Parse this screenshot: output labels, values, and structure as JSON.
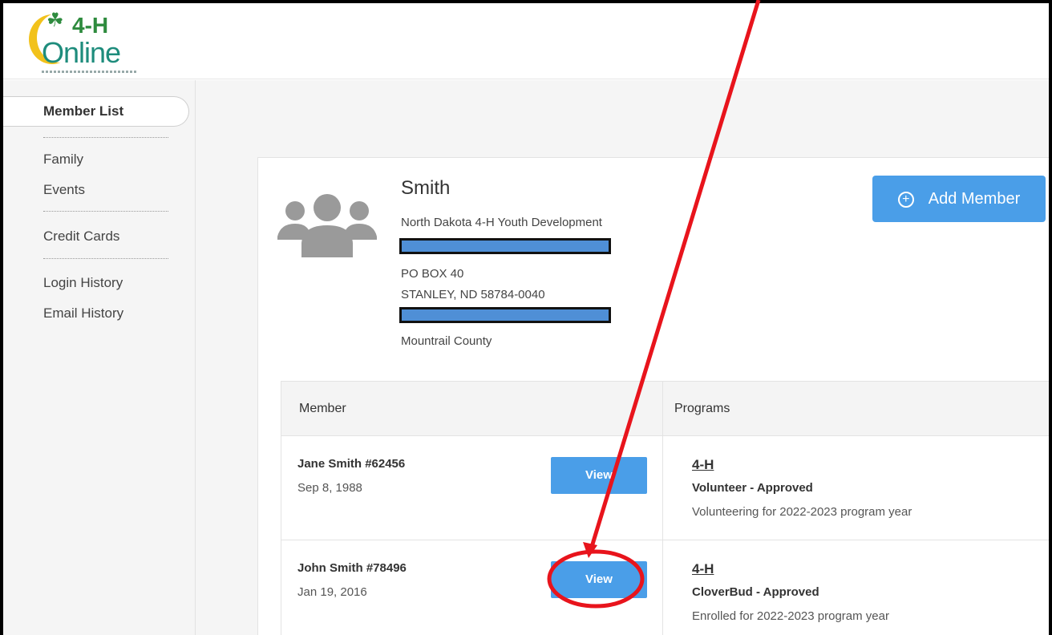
{
  "logo": {
    "mark": "4-H",
    "wordmark": "Online"
  },
  "sidebar": {
    "active": "Member List",
    "items": [
      "Family",
      "Events",
      "Credit Cards",
      "Login History",
      "Email History"
    ]
  },
  "family": {
    "name": "Smith",
    "organization": "North Dakota 4-H Youth Development",
    "address1": "PO BOX 40",
    "address2": "STANLEY, ND 58784-0040",
    "county": "Mountrail County"
  },
  "actions": {
    "add_member": "Add Member"
  },
  "table": {
    "headers": {
      "member": "Member",
      "programs": "Programs"
    },
    "rows": [
      {
        "member": "Jane Smith #62456",
        "dob": "Sep 8, 1988",
        "view": "View",
        "program": "4-H",
        "role": "Volunteer - Approved",
        "note": "Volunteering for 2022-2023 program year"
      },
      {
        "member": "John Smith #78496",
        "dob": "Jan 19, 2016",
        "view": "View",
        "program": "4-H",
        "role": "CloverBud - Approved",
        "note": "Enrolled for 2022-2023 program year"
      }
    ]
  },
  "colors": {
    "accent": "#4a9ee8",
    "annotation": "#e8141c",
    "redaction": "#4f8fd6"
  }
}
